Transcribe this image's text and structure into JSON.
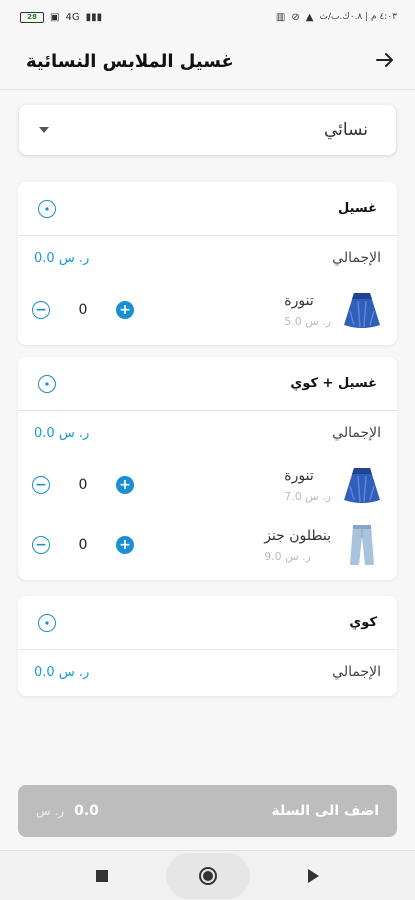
{
  "status_bar": {
    "time": "٤:٠٣ م | ٠.٨ك.ب/ث",
    "battery": "28",
    "network": "4G"
  },
  "header": {
    "title": "غسيل الملابس النسائية",
    "back_icon": "arrow-right-icon"
  },
  "category_select": {
    "value": "نسائي"
  },
  "sections": [
    {
      "title": "غسيل",
      "total_label": "الإجمالي",
      "total_price": "0.0 ر. س",
      "items": [
        {
          "name": "تنورة",
          "price": "5.0 ر. س",
          "qty": "0",
          "image": "skirt"
        }
      ]
    },
    {
      "title": "غسيل + كوي",
      "total_label": "الإجمالي",
      "total_price": "0.0 ر. س",
      "items": [
        {
          "name": "تنورة",
          "price": "7.0 ر. س",
          "qty": "0",
          "image": "skirt"
        },
        {
          "name": "بنطلون جنز",
          "price": "9.0 ر. س",
          "qty": "0",
          "image": "jeans"
        }
      ]
    },
    {
      "title": "كوي",
      "total_label": "الإجمالي",
      "total_price": "0.0 ر. س",
      "items": []
    }
  ],
  "cart": {
    "label": "اضف الى السلة",
    "amount": "0.0",
    "currency": "ر. س"
  },
  "colors": {
    "accent": "#1a8fd4",
    "price_blue": "#1a9ad6",
    "cart_bar": "#bdbdbd"
  }
}
